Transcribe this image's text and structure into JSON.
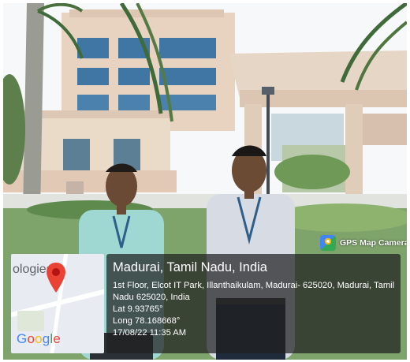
{
  "watermark": {
    "app_name": "GPS Map Camera",
    "icon": "gps-map-camera-icon"
  },
  "gps_stamp": {
    "map": {
      "visible_label": "ologies",
      "pin_icon": "location-pin-icon",
      "attribution": [
        "G",
        "o",
        "o",
        "g",
        "l",
        "e"
      ]
    },
    "place": "Madurai, Tamil Nadu, India",
    "address_line_1": "1st Floor, Elcot IT Park, Illanthaikulam, Madurai- 625020, Madurai, Tamil",
    "address_line_2": "Nadu 625020, India",
    "latitude": "Lat 9.93765°",
    "longitude": "Long 78.168668°",
    "datetime": "17/08/22 11:35 AM"
  },
  "colors": {
    "sky": "#f7f8fa",
    "building": "#e9d8c6",
    "window": "#3f76a3",
    "grass": "#7ea36b",
    "info_box": "#202020",
    "pin": "#ea4335"
  }
}
